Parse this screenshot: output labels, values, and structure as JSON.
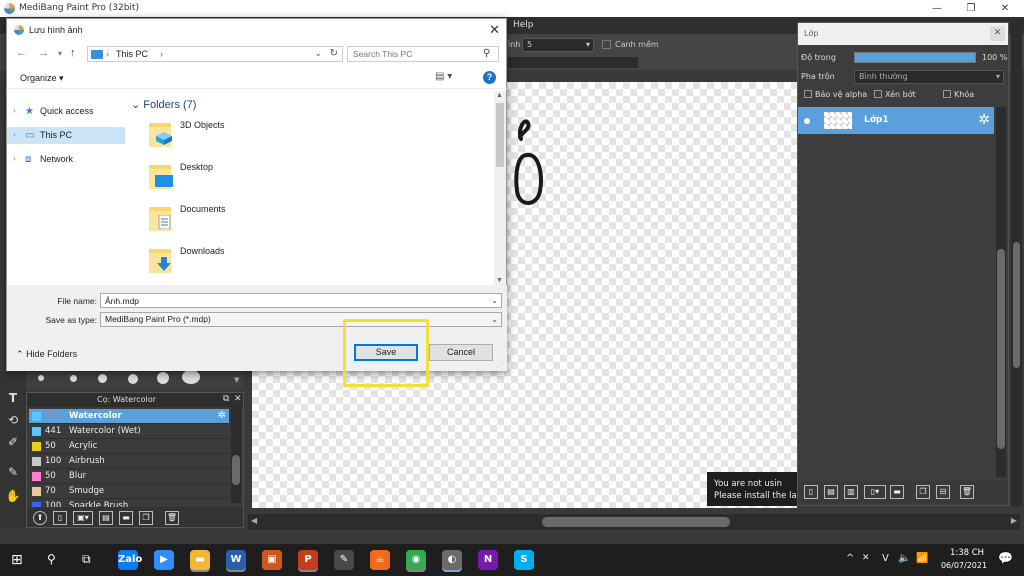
{
  "app": {
    "title": "MediBang Paint Pro (32bit)",
    "menu_help": "Help",
    "toolbar_label_suffix": "ình",
    "toolbar_value": "5",
    "toolbar_check_label": "Canh mềm"
  },
  "window_buttons": [
    "—",
    "❐",
    "✕"
  ],
  "dialog": {
    "title": "Lưu hình ảnh",
    "breadcrumb": [
      "This PC"
    ],
    "search_placeholder": "Search This PC",
    "organize_label": "Organize ▾",
    "nav_items": [
      {
        "label": "Quick access",
        "icon": "star-icon"
      },
      {
        "label": "This PC",
        "icon": "computer-icon",
        "selected": true
      },
      {
        "label": "Network",
        "icon": "network-icon"
      }
    ],
    "group_header": "Folders (7)",
    "folders": [
      {
        "name": "3D Objects",
        "icon": "cube-icon"
      },
      {
        "name": "Desktop",
        "icon": "desktop-icon"
      },
      {
        "name": "Documents",
        "icon": "document-icon"
      },
      {
        "name": "Downloads",
        "icon": "download-icon"
      }
    ],
    "file_name_label": "File name:",
    "file_name_value": "Ảnh.mdp",
    "save_type_label": "Save as type:",
    "save_type_value": "MediBang Paint Pro (*.mdp)",
    "hide_folders_label": "Hide Folders",
    "save_label": "Save",
    "cancel_label": "Cancel"
  },
  "layer_panel": {
    "title": "Lớp",
    "opacity_label": "Độ trong",
    "opacity_value": "100 %",
    "opacity_fraction": 1.0,
    "blend_label": "Pha trộn",
    "blend_value": "Bình thường",
    "protect_alpha_label": "Bảo vệ alpha",
    "clipping_label": "Xén bớt",
    "lock_label": "Khóa",
    "layer_name": "Lớp1"
  },
  "toast": {
    "line1": "You are not usin",
    "line2": "Please install the la"
  },
  "brush_panel": {
    "title": "Cọ: Watercolor",
    "brushes": [
      {
        "size": "15",
        "name": "Watercolor",
        "color": "#5ac8ff",
        "selected": true
      },
      {
        "size": "441",
        "name": "Watercolor (Wet)",
        "color": "#5ac8ff"
      },
      {
        "size": "50",
        "name": "Acrylic",
        "color": "#e8d020"
      },
      {
        "size": "100",
        "name": "Airbrush",
        "color": "#c8c8c8"
      },
      {
        "size": "50",
        "name": "Blur",
        "color": "#ff80d0"
      },
      {
        "size": "70",
        "name": "Smudge",
        "color": "#f0c8a0"
      },
      {
        "size": "100",
        "name": "Sparkle Brush",
        "color": "#4060ff"
      }
    ]
  },
  "taskbar": {
    "apps": [
      {
        "icon": "zalo-icon",
        "label": "Zalo",
        "color": "#0a7ff5"
      },
      {
        "icon": "zoom-icon",
        "label": "▶",
        "color": "#2d8cff"
      },
      {
        "icon": "file-explorer-icon",
        "label": "▬",
        "color": "#f2b835"
      },
      {
        "icon": "word-icon",
        "label": "W",
        "color": "#2b5fae"
      },
      {
        "icon": "photos-icon",
        "label": "▣",
        "color": "#d1571e"
      },
      {
        "icon": "powerpoint-icon",
        "label": "P",
        "color": "#c43e1c"
      },
      {
        "icon": "paint-icon",
        "label": "✎",
        "color": "#4a4a4a"
      },
      {
        "icon": "java-icon",
        "label": "☕",
        "color": "#f26b1d"
      },
      {
        "icon": "chrome-icon",
        "label": "◉",
        "color": "#34a853"
      },
      {
        "icon": "medibang-icon",
        "label": "◐",
        "color": "#6a6a6a"
      },
      {
        "icon": "onenote-icon",
        "label": "N",
        "color": "#7719aa"
      },
      {
        "icon": "skype-icon",
        "label": "S",
        "color": "#00aff0"
      }
    ],
    "tray_icons": [
      "^",
      "V",
      "🔈",
      "📶"
    ],
    "clock_time": "1:38 CH",
    "clock_date": "06/07/2021"
  }
}
